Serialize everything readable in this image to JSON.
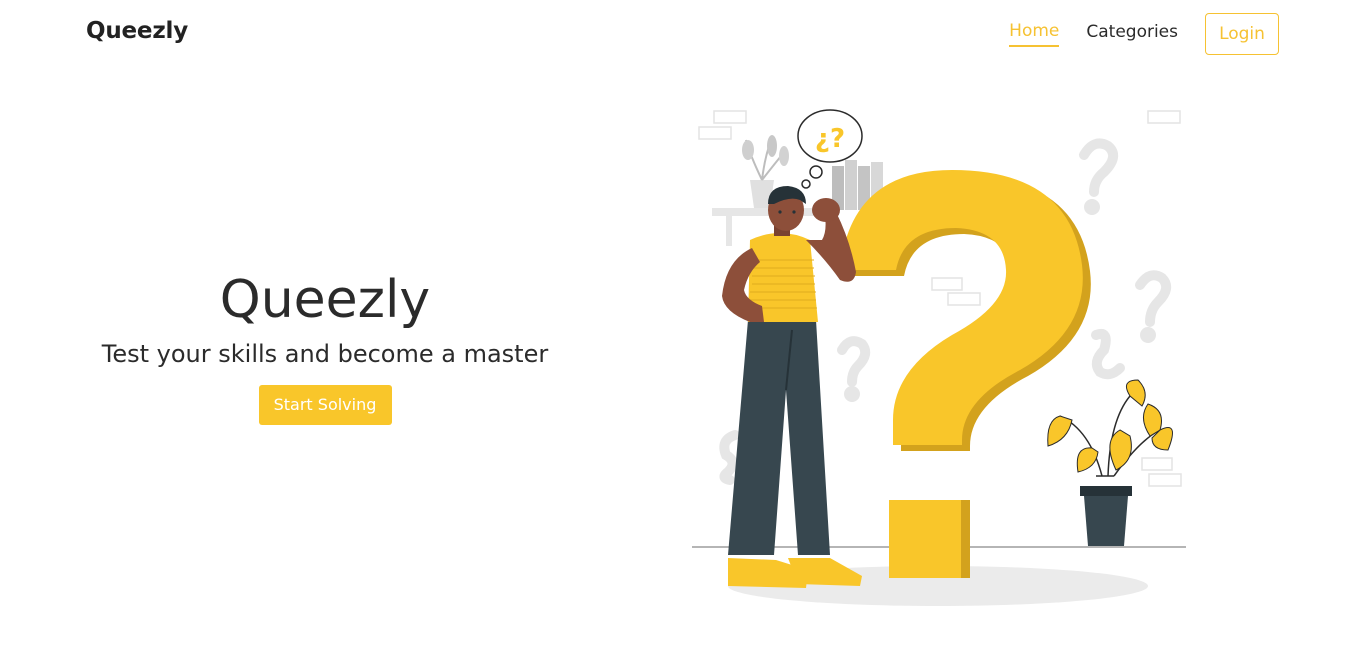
{
  "nav": {
    "brand": "Queezly",
    "links": [
      {
        "label": "Home",
        "active": true
      },
      {
        "label": "Categories",
        "active": false
      }
    ],
    "login_label": "Login"
  },
  "hero": {
    "title": "Queezly",
    "subtitle": "Test your skills and become a master",
    "cta_label": "Start Solving"
  },
  "illustration": {
    "thought_bubble_text": "¿?",
    "accent_color": "#f6c232",
    "dark_color": "#37474f"
  }
}
